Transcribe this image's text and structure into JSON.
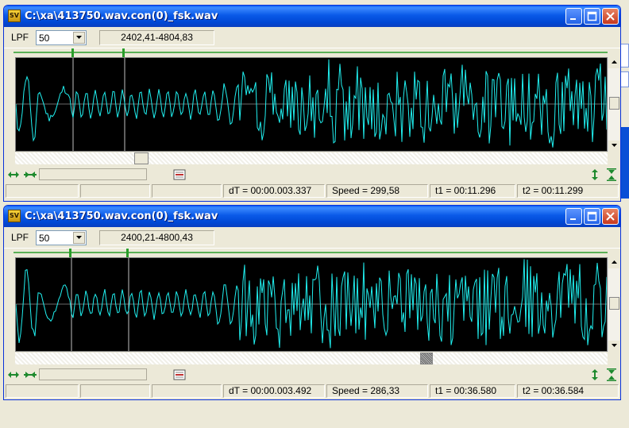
{
  "colors": {
    "waveform": "#20f0f0",
    "scope_bg": "#000000",
    "cursor_line": "#c0c0c0",
    "marker": "#2a9d2a",
    "titlebar": "#0a5ae8"
  },
  "windows": [
    {
      "title": "C:\\xa\\413750.wav.con(0)_fsk.wav",
      "lpf_label": "LPF",
      "lpf_value": "50",
      "freq_range": "2402,41-4804,83",
      "status": {
        "dt": "dT = 00:00.003.337",
        "speed": "Speed = 299,58",
        "t1": "t1 = 00:11.296",
        "t2": "t2 = 00:11.299"
      }
    },
    {
      "title": "C:\\xa\\413750.wav.con(0)_fsk.wav",
      "lpf_label": "LPF",
      "lpf_value": "50",
      "freq_range": "2400,21-4800,43",
      "status": {
        "dt": "dT = 00:00.003.492",
        "speed": "Speed = 286,33",
        "t1": "t1 = 00:36.580",
        "t2": "t2 = 00:36.584"
      }
    }
  ],
  "icons": [
    "app-icon",
    "minimize-icon",
    "maximize-icon",
    "close-icon",
    "zoom-in-horizontal-icon",
    "zoom-out-horizontal-icon",
    "marker-icon",
    "zoom-in-vertical-icon",
    "zoom-out-vertical-icon"
  ]
}
